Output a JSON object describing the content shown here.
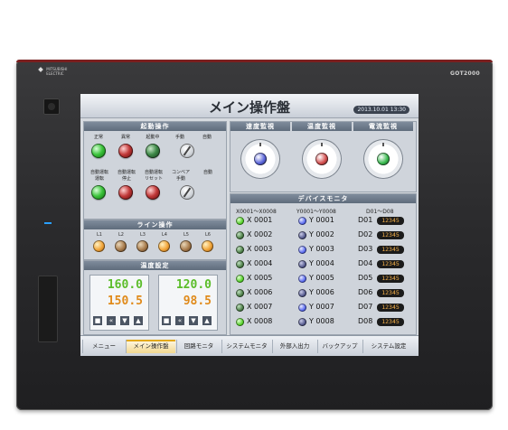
{
  "device": {
    "brand": "MITSUBISHI ELECTRIC",
    "model": "GOT2000"
  },
  "screen": {
    "title": "メイン操作盤",
    "datetime": "2013.10.01 13:30",
    "startup_panel": {
      "header": "起動操作",
      "row1": [
        {
          "label": "正常",
          "lamp": "green-on"
        },
        {
          "label": "異常",
          "lamp": "red"
        },
        {
          "label": "起動中",
          "lamp": "green-dark"
        },
        {
          "label": "手動",
          "lamp": "knob"
        },
        {
          "label": "自動",
          "lamp": "none"
        }
      ],
      "row2": [
        {
          "label": "自動運転",
          "label2": "運転",
          "lamp": "green-on"
        },
        {
          "label": "自動運転",
          "label2": "停止",
          "lamp": "red"
        },
        {
          "label": "自動運転",
          "label2": "リセット",
          "lamp": "red"
        },
        {
          "label": "コンベア",
          "label2": "手動",
          "lamp": "knob"
        },
        {
          "label": "自動",
          "label2": "",
          "lamp": "none"
        }
      ]
    },
    "line_panel": {
      "header": "ライン操作",
      "lamps": [
        {
          "label": "L1",
          "state": "on"
        },
        {
          "label": "L2",
          "state": "off"
        },
        {
          "label": "L3",
          "state": "off"
        },
        {
          "label": "L4",
          "state": "on"
        },
        {
          "label": "L5",
          "state": "off"
        },
        {
          "label": "L6",
          "state": "on"
        }
      ]
    },
    "temp_set_panel": {
      "header": "温度設定",
      "boxes": [
        {
          "sv": "160.0",
          "pv": "150.5"
        },
        {
          "sv": "120.0",
          "pv": "98.5"
        }
      ],
      "controls": [
        "■",
        "«",
        "▼",
        "▲"
      ]
    },
    "monitors": [
      {
        "header": "速度監視",
        "dot_color": "#5560d8"
      },
      {
        "header": "温度監視",
        "dot_color": "#d24a4a"
      },
      {
        "header": "電流監視",
        "dot_color": "#34b84a"
      }
    ],
    "device_monitor": {
      "header": "デバイスモニタ",
      "col_headers": [
        "X0001～X0008",
        "Y0001～Y0008",
        "D01～D08"
      ],
      "rows": [
        {
          "x": "X 0001",
          "x_on": true,
          "y": "Y 0001",
          "y_on": true,
          "d": "D01",
          "dv": "12345"
        },
        {
          "x": "X 0002",
          "x_on": false,
          "y": "Y 0002",
          "y_on": false,
          "d": "D02",
          "dv": "12345"
        },
        {
          "x": "X 0003",
          "x_on": false,
          "y": "Y 0003",
          "y_on": true,
          "d": "D03",
          "dv": "12345"
        },
        {
          "x": "X 0004",
          "x_on": false,
          "y": "Y 0004",
          "y_on": false,
          "d": "D04",
          "dv": "12345"
        },
        {
          "x": "X 0005",
          "x_on": true,
          "y": "Y 0005",
          "y_on": true,
          "d": "D05",
          "dv": "12345"
        },
        {
          "x": "X 0006",
          "x_on": false,
          "y": "Y 0006",
          "y_on": false,
          "d": "D06",
          "dv": "12345"
        },
        {
          "x": "X 0007",
          "x_on": false,
          "y": "Y 0007",
          "y_on": true,
          "d": "D07",
          "dv": "12345"
        },
        {
          "x": "X 0008",
          "x_on": true,
          "y": "Y 0008",
          "y_on": false,
          "d": "D08",
          "dv": "12345"
        }
      ]
    },
    "menu": [
      {
        "label": "メニュー",
        "active": false
      },
      {
        "label": "メイン操作盤",
        "active": true
      },
      {
        "label": "回路モニタ",
        "active": false
      },
      {
        "label": "システムモニタ",
        "active": false
      },
      {
        "label": "外部入出力",
        "active": false
      },
      {
        "label": "バックアップ",
        "active": false
      },
      {
        "label": "システム設定",
        "active": false
      }
    ]
  }
}
